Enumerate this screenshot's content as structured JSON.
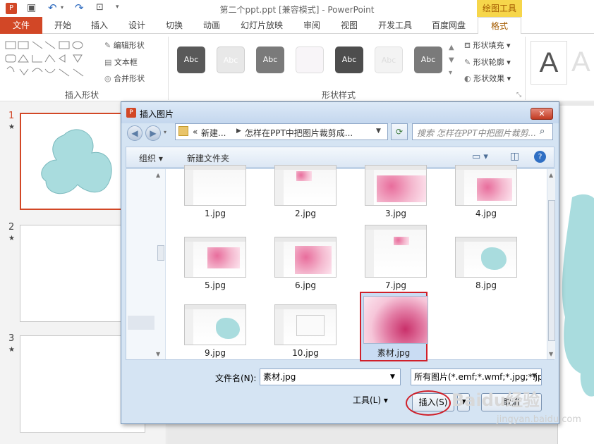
{
  "window": {
    "title": "第二个ppt.ppt [兼容模式] - PowerPoint",
    "context_tab": "绘图工具"
  },
  "ribbon": {
    "tabs": [
      "文件",
      "开始",
      "插入",
      "设计",
      "切换",
      "动画",
      "幻灯片放映",
      "审阅",
      "视图",
      "开发工具",
      "百度网盘",
      "格式"
    ],
    "insert_shapes": {
      "label": "插入形状",
      "edit_shape": "编辑形状",
      "text_box": "文本框",
      "merge_shapes": "合并形状"
    },
    "shape_styles": {
      "label": "形状样式",
      "sample_text": "Abc",
      "fill": "形状填充",
      "outline": "形状轮廓",
      "effects": "形状效果"
    },
    "wordart_letter": "A"
  },
  "slides": [
    {
      "number": "1",
      "selected": true
    },
    {
      "number": "2",
      "selected": false
    },
    {
      "number": "3",
      "selected": false
    }
  ],
  "dialog": {
    "title": "插入图片",
    "breadcrumb": [
      "新建...",
      "怎样在PPT中把图片裁剪成..."
    ],
    "breadcrumb_prefix": "«",
    "search_placeholder": "搜索 怎样在PPT中把图片裁剪...",
    "organize": "组织",
    "new_folder": "新建文件夹",
    "files": [
      "1.jpg",
      "2.jpg",
      "3.jpg",
      "4.jpg",
      "5.jpg",
      "6.jpg",
      "7.jpg",
      "8.jpg",
      "9.jpg",
      "10.jpg",
      "素材.jpg"
    ],
    "selected_file": "素材.jpg",
    "filename_label": "文件名(N):",
    "filename_value": "素材.jpg",
    "filetype_value": "所有图片(*.emf;*.wmf;*.jpg;*.jp",
    "tools_label": "工具(L)",
    "insert_button": "插入(S)",
    "cancel_button": "取消"
  },
  "watermark": {
    "line1": "Baidu经验",
    "line2": "jingyan.baidu.com"
  },
  "colors": {
    "file_tab": "#d24726",
    "context_tab": "#f6d64b",
    "highlight": "#d0202a"
  }
}
